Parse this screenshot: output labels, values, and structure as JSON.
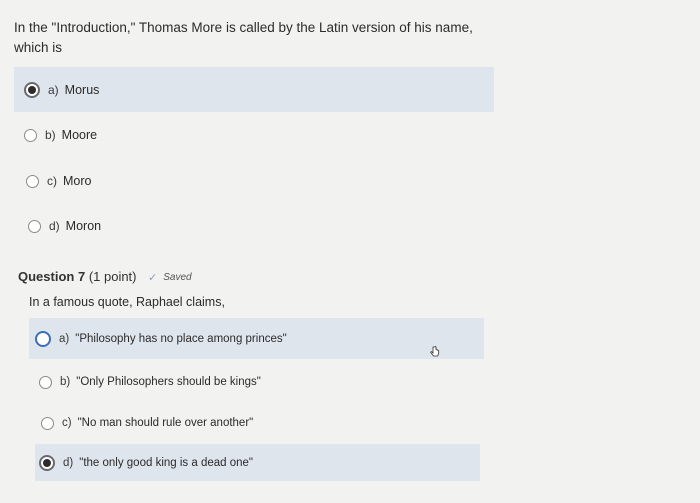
{
  "question6": {
    "text": "In the \"Introduction,\" Thomas More is called by the Latin version of his name, which is",
    "options": [
      {
        "letter": "a)",
        "text": "Morus",
        "selected": true
      },
      {
        "letter": "b)",
        "text": "Moore",
        "selected": false
      },
      {
        "letter": "c)",
        "text": "Moro",
        "selected": false
      },
      {
        "letter": "d)",
        "text": "Moron",
        "selected": false
      }
    ]
  },
  "question7": {
    "title": "Question 7",
    "points": "(1 point)",
    "saved_label": "Saved",
    "text": "In a famous quote, Raphael claims,",
    "options": [
      {
        "letter": "a)",
        "text": "\"Philosophy has no place among princes\"",
        "selected": false,
        "highlighted": true
      },
      {
        "letter": "b)",
        "text": "\"Only Philosophers should be kings\"",
        "selected": false
      },
      {
        "letter": "c)",
        "text": "\"No man should rule over another\"",
        "selected": false
      },
      {
        "letter": "d)",
        "text": "\"the only good king is a dead one\"",
        "selected": true
      }
    ]
  },
  "icons": {
    "check": "checkmark-icon",
    "cursor": "hand-pointer-icon"
  },
  "colors": {
    "selected_bg": "#dfe5ec",
    "page_bg": "#f2f2f0",
    "accent_radio": "#3d6fb6"
  }
}
